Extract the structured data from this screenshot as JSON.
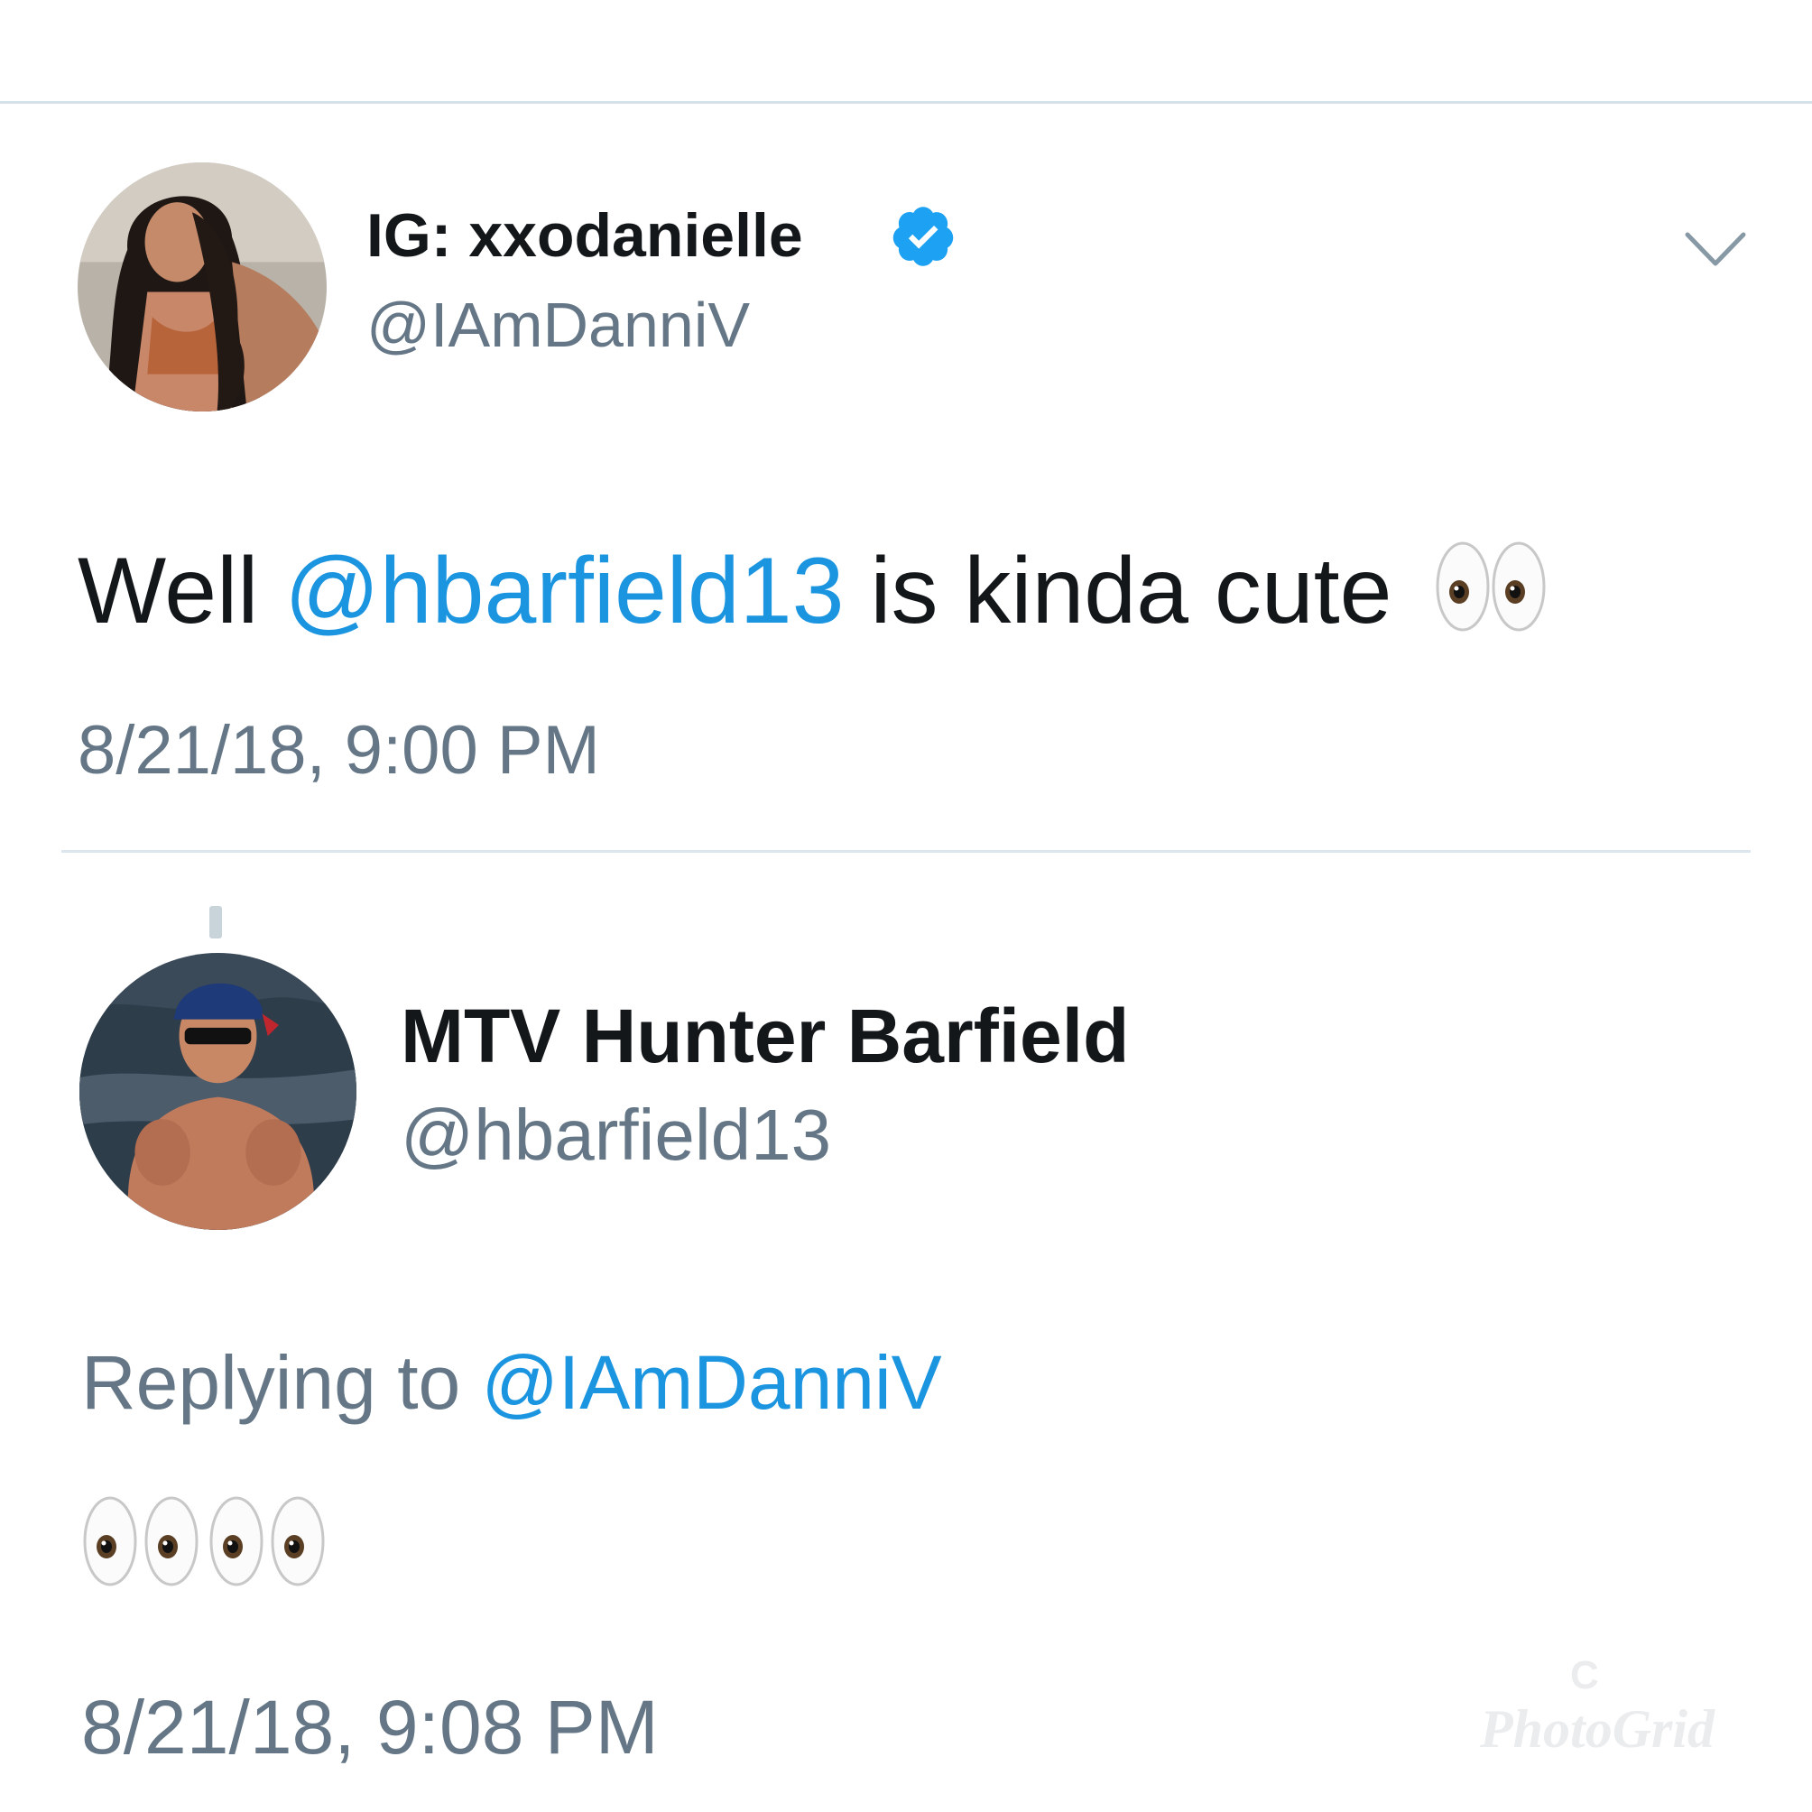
{
  "tweet": {
    "display_name": "IG: xxodanielle",
    "handle": "@IAmDanniV",
    "text_before": "Well ",
    "mention": "@hbarfield13",
    "text_after": " is kinda cute ",
    "emoji": "eyes",
    "timestamp": "8/21/18, 9:00 PM",
    "verified": true,
    "menu_icon": "chevron-down-icon"
  },
  "reply": {
    "display_name": "MTV Hunter Barfield",
    "handle": "@hbarfield13",
    "replying_label": "Replying to ",
    "replying_handle": "@IAmDanniV",
    "emoji": "eyes x4",
    "timestamp": "8/21/18, 9:08 PM"
  },
  "watermark": {
    "mark": "C",
    "text": "PhotoGrid"
  },
  "colors": {
    "link": "#1b95e0",
    "muted": "#657786",
    "text": "#14171a",
    "divider": "#d6e2ea"
  }
}
